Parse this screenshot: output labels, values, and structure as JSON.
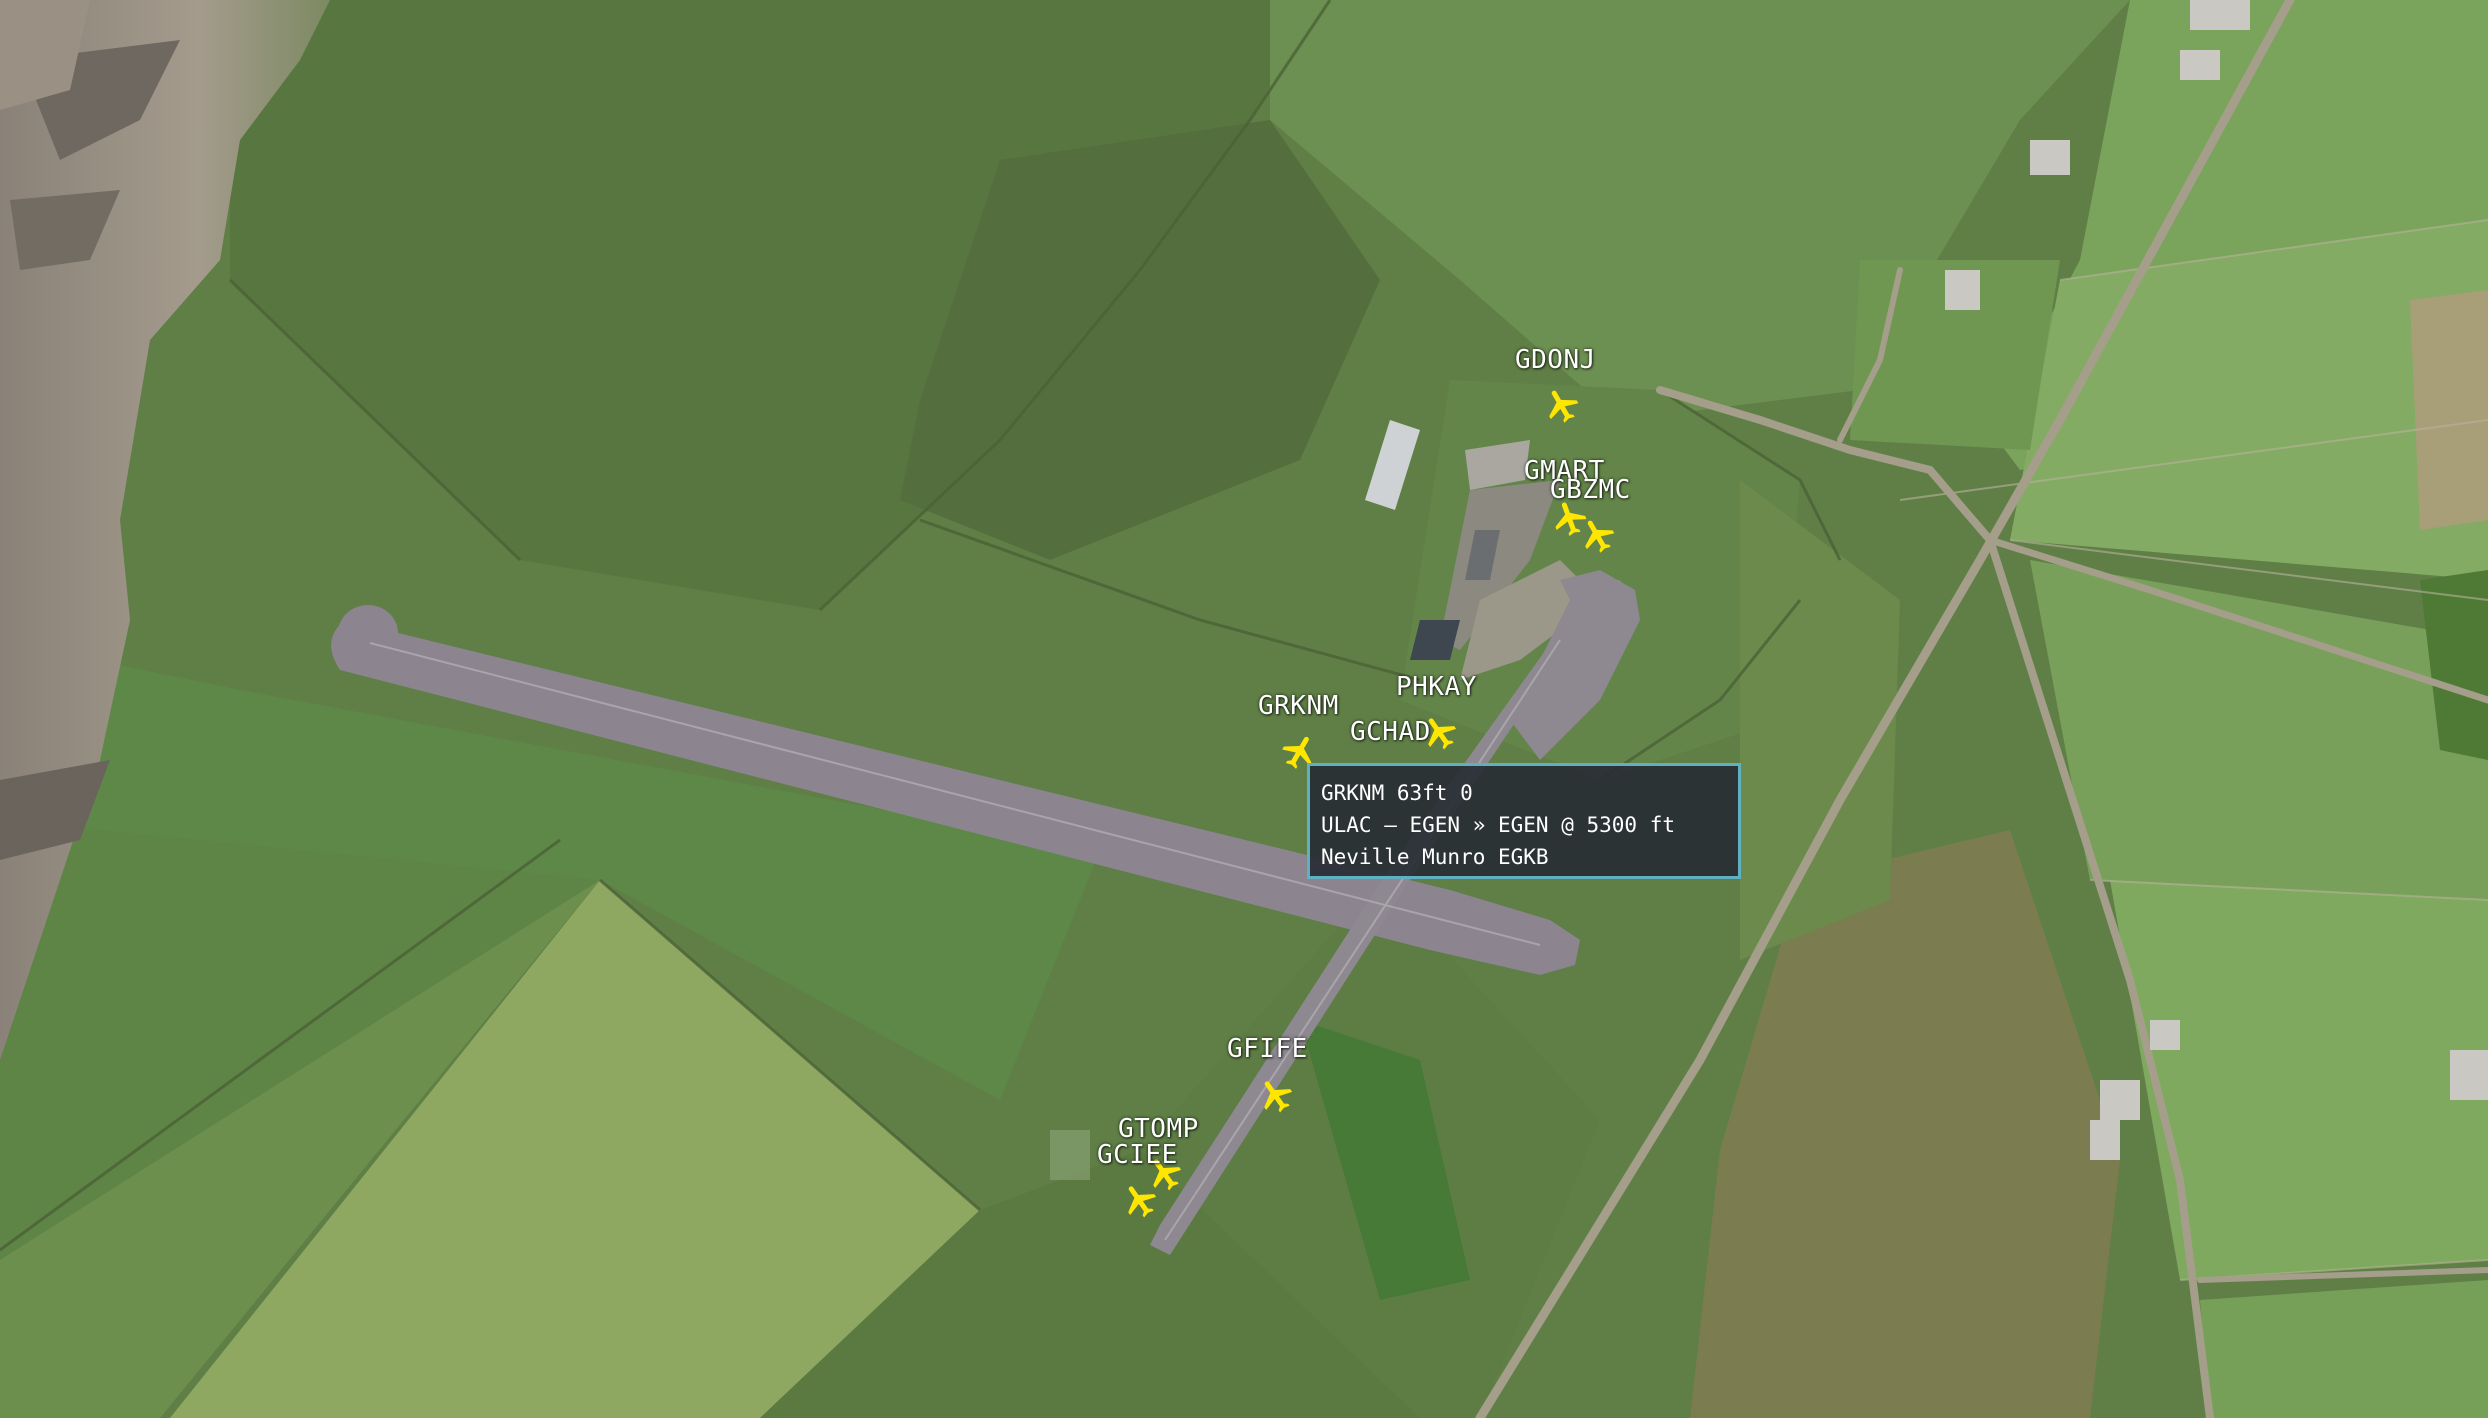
{
  "aircraft": [
    {
      "id": "a1",
      "callsign": "GDONJ"
    },
    {
      "id": "a2",
      "callsign": "GMART"
    },
    {
      "id": "a3",
      "callsign": "GBZMC"
    },
    {
      "id": "a4",
      "callsign": "GRKNM"
    },
    {
      "id": "a5",
      "callsign": "PHKAY"
    },
    {
      "id": "a6",
      "callsign": "GCHAD"
    },
    {
      "id": "a7",
      "callsign": "GFIFE"
    },
    {
      "id": "a8",
      "callsign": "GTOMP"
    },
    {
      "id": "a9",
      "callsign": "GCIEE"
    }
  ],
  "tooltip": {
    "line1": "GRKNM 63ft 0",
    "line2": "ULAC – EGEN » EGEN @ 5300 ft",
    "line3": "Neville Munro EGKB"
  },
  "colors": {
    "aircraft_icon": "#ffe600",
    "tooltip_border": "#5fb0c0"
  }
}
